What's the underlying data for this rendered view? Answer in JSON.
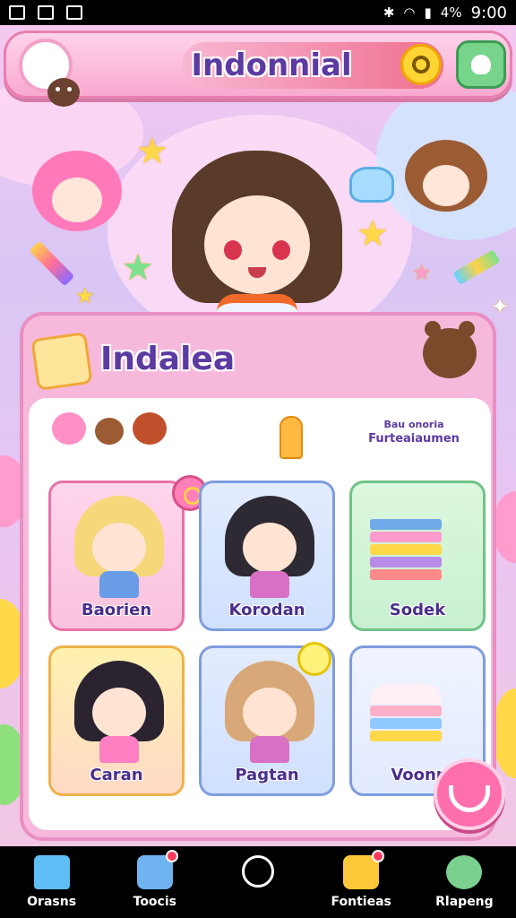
{
  "status_bar": {
    "battery": "4%",
    "time": "9:00"
  },
  "header": {
    "title": "Indonnial"
  },
  "panel": {
    "title": "Indalea",
    "feature_label_top": "Bau onoria",
    "feature_label_main": "Furteaiaumen"
  },
  "cards": [
    {
      "label": "Baorien"
    },
    {
      "label": "Korodan"
    },
    {
      "label": "Sodek"
    },
    {
      "label": "Caran"
    },
    {
      "label": "Pagtan"
    },
    {
      "label": "Voonr"
    }
  ],
  "nav": [
    {
      "label": "Orasns",
      "icon": "home-icon"
    },
    {
      "label": "Toocis",
      "icon": "calendar-icon"
    },
    {
      "label": "",
      "icon": "chat-icon"
    },
    {
      "label": "Fontieas",
      "icon": "books-icon"
    },
    {
      "label": "Rlapeng",
      "icon": "globe-icon"
    }
  ],
  "colors": {
    "header_pink": "#f8a9cf",
    "title_purple": "#5b3aa1",
    "fab_pink": "#ff6fae"
  }
}
